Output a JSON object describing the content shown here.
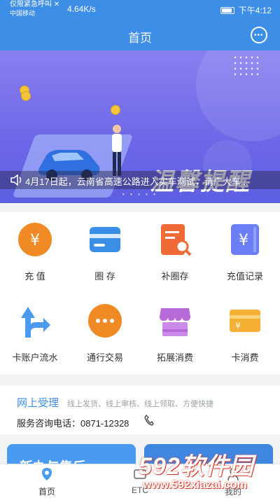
{
  "status": {
    "line1": "仅限紧急呼叫 ✕",
    "line2": "中国移动",
    "speed": "4.64K/s",
    "time": "下午4:12"
  },
  "header": {
    "title": "首页",
    "message_icon": "chat-bubble-icon"
  },
  "banner": {
    "title": "温馨提醒",
    "notice": "4月17日起，云南省高速公路进入实车测试，请广大车..."
  },
  "grid": [
    {
      "label": "充 值",
      "icon": "yuan-circle-icon",
      "color": "#f08a24"
    },
    {
      "label": "圈 存",
      "icon": "card-icon",
      "color": "#3a8ee6"
    },
    {
      "label": "补圈存",
      "icon": "document-search-icon",
      "color": "#ee6a37"
    },
    {
      "label": "充值记录",
      "icon": "yuan-book-icon",
      "color": "#6b7ef5"
    },
    {
      "label": "卡账户流水",
      "icon": "split-arrow-icon",
      "color": "#4a9bef"
    },
    {
      "label": "通行交易",
      "icon": "more-dots-icon",
      "color": "#f08a24"
    },
    {
      "label": "拓展消费",
      "icon": "store-icon",
      "color": "#b56ad8"
    },
    {
      "label": "卡消费",
      "icon": "yuan-card-icon",
      "color": "#f4b133"
    }
  ],
  "service": {
    "heading": "网上受理",
    "sub": "线上发货、线上审核、线上领取、方便快捷",
    "phone": "服务咨询电话：0871-12328"
  },
  "tiles": {
    "left_title": "新办与售后"
  },
  "tabs": [
    {
      "label": "首页",
      "icon": "location-pin-icon"
    },
    {
      "label": "ETC",
      "icon": "etc-icon"
    },
    {
      "label": "",
      "icon": ""
    },
    {
      "label": "我的",
      "icon": "user-icon"
    }
  ],
  "watermark": {
    "brand": "592软件园",
    "url": "www.592xiazai.com"
  }
}
